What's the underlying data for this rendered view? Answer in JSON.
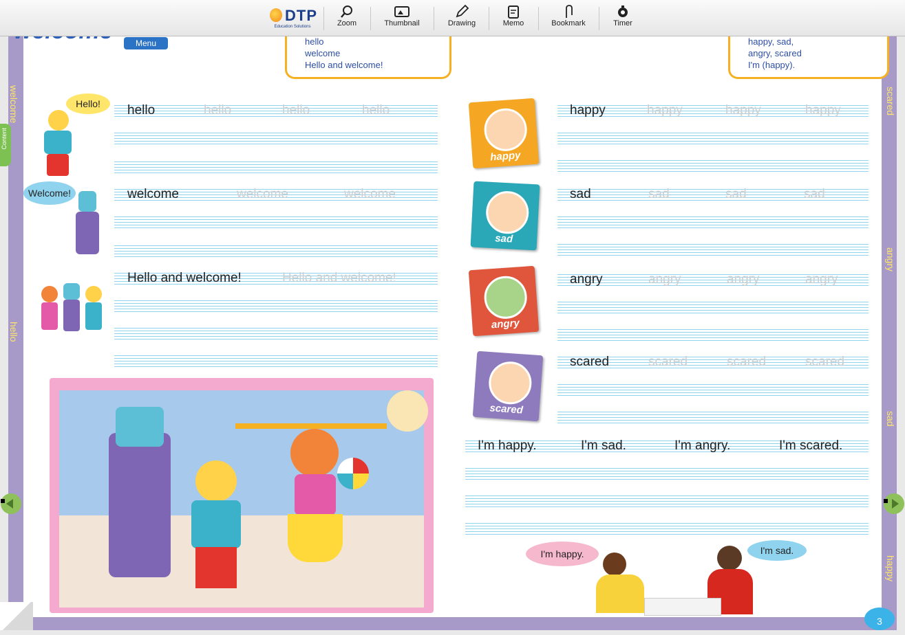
{
  "toolbar": {
    "logo_text": "DTP",
    "logo_sub": "Education Solutions",
    "tools": [
      {
        "label": "Zoom",
        "icon": "zoom-icon"
      },
      {
        "label": "Thumbnail",
        "icon": "thumbnail-icon"
      },
      {
        "label": "Drawing",
        "icon": "pencil-icon"
      },
      {
        "label": "Memo",
        "icon": "memo-icon"
      },
      {
        "label": "Bookmark",
        "icon": "bookmark-icon"
      },
      {
        "label": "Timer",
        "icon": "timer-icon"
      }
    ]
  },
  "header": {
    "title_partial": "welcome",
    "menu_label": "Menu"
  },
  "side_tab": {
    "label": "Content"
  },
  "left_vertical": [
    "welcome",
    "hello"
  ],
  "right_vertical": [
    "scared",
    "angry",
    "sad",
    "happy"
  ],
  "vocab_box_left": [
    "hello",
    "welcome",
    "Hello and welcome!"
  ],
  "vocab_box_right": [
    "happy, sad,",
    "angry, scared",
    "I'm (happy)."
  ],
  "left_rows": [
    {
      "word": "hello",
      "traces": [
        "hello",
        "hello",
        "hello"
      ],
      "bubble": "Hello!"
    },
    {
      "word": "welcome",
      "traces": [
        "welcome",
        "welcome"
      ],
      "bubble": "Welcome!"
    },
    {
      "word": "Hello and welcome!",
      "traces": [
        "Hello and welcome!"
      ],
      "bubble": ""
    }
  ],
  "right_rows": [
    {
      "word": "happy",
      "traces": [
        "happy",
        "happy",
        "happy"
      ],
      "card": "happy",
      "color": "#f5a623"
    },
    {
      "word": "sad",
      "traces": [
        "sad",
        "sad",
        "sad"
      ],
      "card": "sad",
      "color": "#2aa8b7"
    },
    {
      "word": "angry",
      "traces": [
        "angry",
        "angry",
        "angry"
      ],
      "card": "angry",
      "color": "#e0563c"
    },
    {
      "word": "scared",
      "traces": [
        "scared",
        "scared",
        "scared"
      ],
      "card": "scared",
      "color": "#8d7bbd"
    }
  ],
  "sentences": [
    "I'm happy.",
    "I'm sad.",
    "I'm angry.",
    "I'm scared."
  ],
  "photo_bubbles": {
    "girl": "I'm happy.",
    "boy": "I'm sad."
  },
  "page_number": "3"
}
